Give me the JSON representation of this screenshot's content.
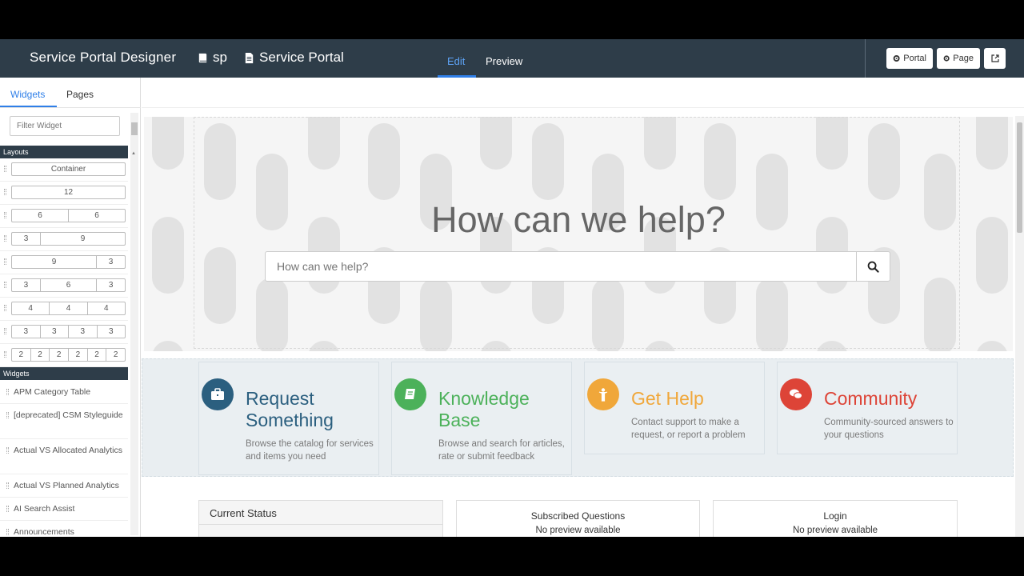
{
  "header": {
    "title": "Service Portal Designer",
    "crumb1": "sp",
    "crumb2": "Service Portal",
    "edit_label": "Edit",
    "preview_label": "Preview",
    "portal_btn": "Portal",
    "page_btn": "Page"
  },
  "sidebar": {
    "tabs": [
      "Widgets",
      "Pages"
    ],
    "filter_placeholder": "Filter Widget",
    "layouts_header": "Layouts",
    "widgets_header": "Widgets",
    "layouts": [
      [
        "Container"
      ],
      [
        "12"
      ],
      [
        "6",
        "6"
      ],
      [
        "3",
        "9"
      ],
      [
        "9",
        "3"
      ],
      [
        "3",
        "6",
        "3"
      ],
      [
        "4",
        "4",
        "4"
      ],
      [
        "3",
        "3",
        "3",
        "3"
      ],
      [
        "2",
        "2",
        "2",
        "2",
        "2",
        "2"
      ]
    ],
    "widgets": [
      "APM Category Table",
      "[deprecated] CSM Styleguide",
      "Actual VS Allocated Analytics",
      "Actual VS Planned Analytics",
      "AI Search Assist",
      "Announcements"
    ]
  },
  "hero": {
    "title": "How can we help?",
    "search_placeholder": "How can we help?"
  },
  "cards": [
    {
      "title": "Request Something",
      "desc": "Browse the catalog for services and items you need",
      "color": "#2b5f7f",
      "icon": "briefcase-icon"
    },
    {
      "title": "Knowledge Base",
      "desc": "Browse and search for articles, rate or submit feedback",
      "color": "#4cb15a",
      "icon": "book-icon"
    },
    {
      "title": "Get Help",
      "desc": "Contact support to make a request, or report a problem",
      "color": "#f0a73a",
      "icon": "person-icon"
    },
    {
      "title": "Community",
      "desc": "Community-sourced answers to your questions",
      "color": "#dd4437",
      "icon": "chat-icon"
    }
  ],
  "panels": {
    "current_status": "Current Status",
    "subscribed": "Subscribed Questions",
    "login": "Login",
    "no_preview": "No preview available"
  }
}
